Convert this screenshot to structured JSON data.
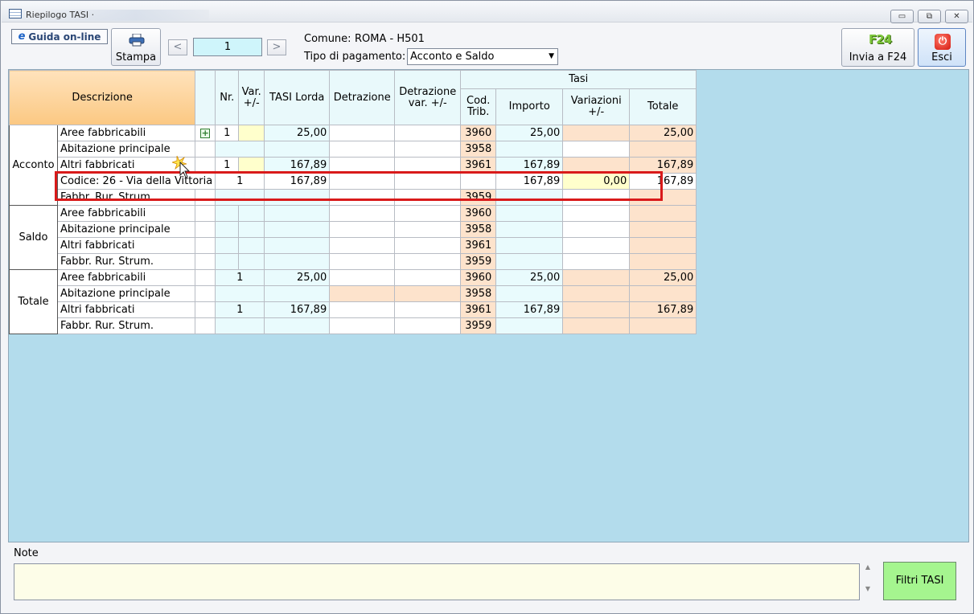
{
  "window": {
    "title": "Riepilogo TASI ·",
    "controls": [
      "▭",
      "⧉",
      "✕"
    ]
  },
  "toolbar": {
    "guide_label": "Guida on-line",
    "print_label": "Stampa",
    "prev_label": "<",
    "next_label": ">",
    "page_value": "1",
    "comune_label": "Comune:",
    "comune_value": "ROMA - H501",
    "payment_type_label": "Tipo di pagamento:",
    "payment_type_value": "Acconto e Saldo",
    "send_label": "Invia a F24",
    "f24_icon_text": "F24",
    "exit_label": "Esci"
  },
  "table": {
    "headers": {
      "descrizione": "Descrizione",
      "nr": "Nr.",
      "var": "Var. +/-",
      "tasi_lorda": "TASI Lorda",
      "detrazione": "Detrazione",
      "detrazione_var": "Detrazione var. +/-",
      "tasi_group": "Tasi",
      "cod_trib": "Cod. Trib.",
      "importo": "Importo",
      "variazioni": "Variazioni +/-",
      "totale": "Totale"
    },
    "groups": {
      "acconto": "Acconto",
      "saldo": "Saldo",
      "totale": "Totale"
    },
    "acconto_rows": [
      {
        "desc": "Aree fabbricabili",
        "nr": "1",
        "lorda": "25,00",
        "cod": "3960",
        "importo": "25,00",
        "totale": "25,00"
      },
      {
        "desc": "Abitazione principale",
        "nr": "",
        "lorda": "",
        "cod": "3958",
        "importo": "",
        "totale": ""
      },
      {
        "desc": "Altri fabbricati",
        "nr": "1",
        "lorda": "167,89",
        "cod": "3961",
        "importo": "167,89",
        "totale": "167,89"
      },
      {
        "desc": "Fabbr. Rur. Strum.",
        "nr": "",
        "lorda": "",
        "cod": "3959",
        "importo": "",
        "totale": ""
      }
    ],
    "detail_row": {
      "desc": "Codice: 26 - Via della Vittoria",
      "nr": "1",
      "lorda": "167,89",
      "importo": "167,89",
      "variazioni": "0,00",
      "totale": "167,89"
    },
    "saldo_rows": [
      {
        "desc": "Aree fabbricabili",
        "cod": "3960"
      },
      {
        "desc": "Abitazione principale",
        "cod": "3958"
      },
      {
        "desc": "Altri fabbricati",
        "cod": "3961"
      },
      {
        "desc": "Fabbr. Rur. Strum.",
        "cod": "3959"
      }
    ],
    "totale_rows": [
      {
        "desc": "Aree fabbricabili",
        "nr": "1",
        "lorda": "25,00",
        "cod": "3960",
        "importo": "25,00",
        "totale": "25,00"
      },
      {
        "desc": "Abitazione principale",
        "nr": "",
        "lorda": "",
        "cod": "3958",
        "importo": "",
        "totale": ""
      },
      {
        "desc": "Altri fabbricati",
        "nr": "1",
        "lorda": "167,89",
        "cod": "3961",
        "importo": "167,89",
        "totale": "167,89"
      },
      {
        "desc": "Fabbr. Rur. Strum.",
        "nr": "",
        "lorda": "",
        "cod": "3959",
        "importo": "",
        "totale": ""
      }
    ]
  },
  "notes": {
    "label": "Note",
    "value": ""
  },
  "filter_button": "Filtri TASI",
  "colors": {
    "grid_bg": "#b3dcec",
    "highlight": "#d91a1a",
    "filter_btn": "#a5f58f"
  }
}
